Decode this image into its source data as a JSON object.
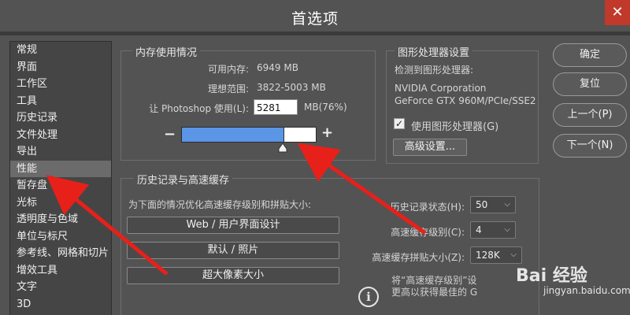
{
  "window": {
    "title": "首选项",
    "close_glyph": "✕"
  },
  "sidebar": {
    "items": [
      "常规",
      "界面",
      "工作区",
      "工具",
      "历史记录",
      "文件处理",
      "导出",
      "性能",
      "暂存盘",
      "光标",
      "透明度与色域",
      "单位与标尺",
      "参考线、网格和切片",
      "增效工具",
      "文字",
      "3D"
    ],
    "active_index": 7
  },
  "memory": {
    "group_title": "内存使用情况",
    "available_label": "可用内存:",
    "available_value": "6949 MB",
    "ideal_label": "理想范围:",
    "ideal_value": "3822-5003 MB",
    "let_label": "让 Photoshop 使用(L):",
    "let_value": "5281",
    "let_unit": "MB(76%)",
    "minus": "−",
    "plus": "+",
    "usage_fraction": 0.76
  },
  "gpu": {
    "group_title": "图形处理器设置",
    "detected_label": "检测到图形处理器:",
    "vendor": "NVIDIA Corporation",
    "model": "GeForce GTX 960M/PCIe/SSE2",
    "use_gpu_label": "使用图形处理器(G)",
    "use_gpu_checked": true,
    "advanced_button": "高级设置..."
  },
  "history_cache": {
    "group_title": "历史记录与高速缓存",
    "optimize_label": "为下面的情况优化高速缓存级别和拼贴大小:",
    "buttons": [
      "Web / 用户界面设计",
      "默认 / 照片",
      "超大像素大小"
    ],
    "history_states_label": "历史记录状态(H):",
    "history_states_value": "50",
    "cache_levels_label": "高速缓存级别(C):",
    "cache_levels_value": "4",
    "tile_size_label": "高速缓存拼贴大小(Z):",
    "tile_size_value": "128K",
    "note_line1": "将“高速缓存级别”设",
    "note_line2": "更高以获得最佳的 G"
  },
  "actions": {
    "ok": "确定",
    "reset": "复位",
    "prev": "上一个(P)",
    "next": "下一个(N)"
  },
  "watermark": {
    "text": "Bai  经验",
    "sub": "jingyan.baidu.com"
  },
  "colors": {
    "accent_bar": "#5b95e6",
    "arrow": "#e8201a",
    "close": "#c0392b"
  }
}
